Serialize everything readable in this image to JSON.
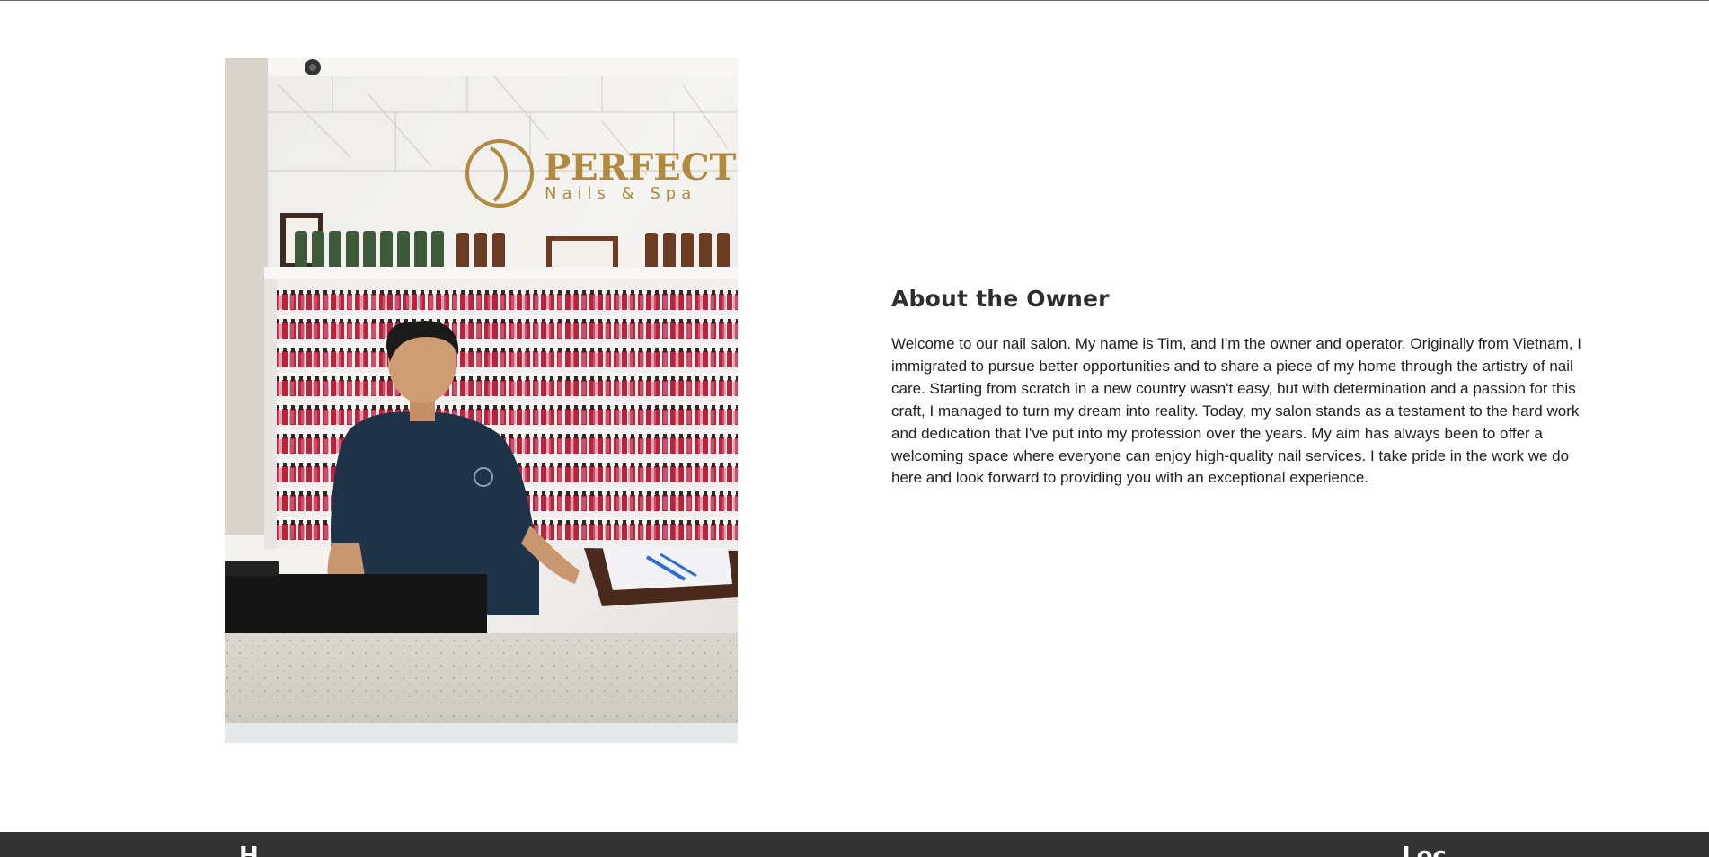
{
  "photo": {
    "alt": "Owner standing behind the front desk of the nail salon",
    "sign_brand": "PERFECT",
    "sign_sub": "Nails & Spa"
  },
  "about": {
    "heading": "About the Owner",
    "body": "Welcome to our nail salon. My name is Tim, and I'm the owner and operator. Originally from Vietnam, I immigrated to pursue better opportunities and to share a piece of my home through the artistry of nail care. Starting from scratch in a new country wasn't easy, but with determination and a passion for this craft, I managed to turn my dream into reality. Today, my salon stands as a testament to the hard work and dedication that I've put into my profession over the years. My aim has always been to offer a welcoming space where everyone can enjoy high-quality nail services. I take pride in the work we do here and look forward to providing you with an exceptional experience."
  },
  "footer": {
    "left_heading": "H",
    "right_heading": "Loc"
  },
  "colors": {
    "footer_bg": "#333333",
    "text": "#1f1f1f",
    "sign_gold": "#b08a3e"
  }
}
